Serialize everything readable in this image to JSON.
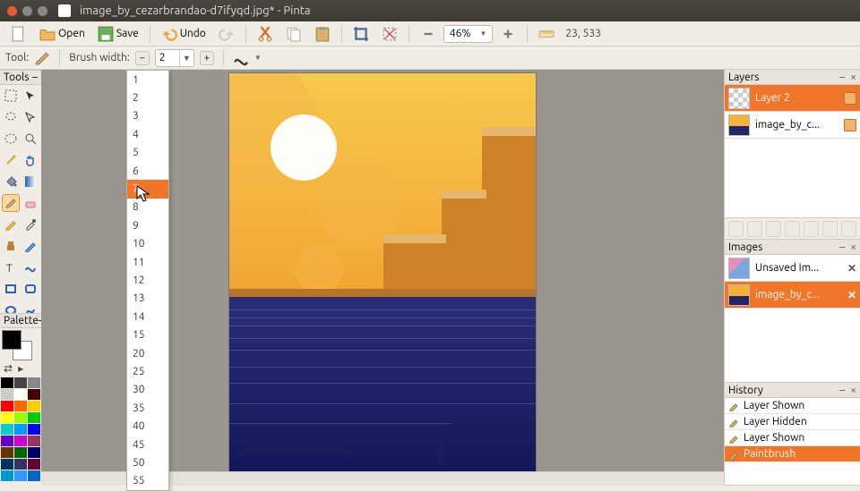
{
  "window": {
    "title": "image_by_cezarbrandao-d7ifyqd.jpg* - Pinta"
  },
  "toolbar": {
    "open": "Open",
    "save": "Save",
    "undo": "Undo",
    "zoom": "46%",
    "coords": "23, 533"
  },
  "toolopts": {
    "tool_label": "Tool:",
    "brush_width_label": "Brush width:",
    "brush_width_value": "2"
  },
  "dropdown": {
    "items": [
      "1",
      "2",
      "3",
      "4",
      "5",
      "6",
      "7",
      "8",
      "9",
      "10",
      "11",
      "12",
      "13",
      "14",
      "15",
      "20",
      "25",
      "30",
      "35",
      "40",
      "45",
      "50",
      "55"
    ],
    "highlighted": "7"
  },
  "tools": {
    "header": "Tools"
  },
  "palette": {
    "header": "Palette"
  },
  "layers": {
    "header": "Layers",
    "rows": [
      {
        "name": "Layer 2",
        "checked": true
      },
      {
        "name": "image_by_c...",
        "checked": true
      }
    ]
  },
  "images": {
    "header": "Images",
    "rows": [
      {
        "name": "Unsaved Im..."
      },
      {
        "name": "image_by_c..."
      }
    ]
  },
  "history": {
    "header": "History",
    "rows": [
      "Layer Shown",
      "Layer Hidden",
      "Layer Shown",
      "Paintbrush"
    ]
  }
}
